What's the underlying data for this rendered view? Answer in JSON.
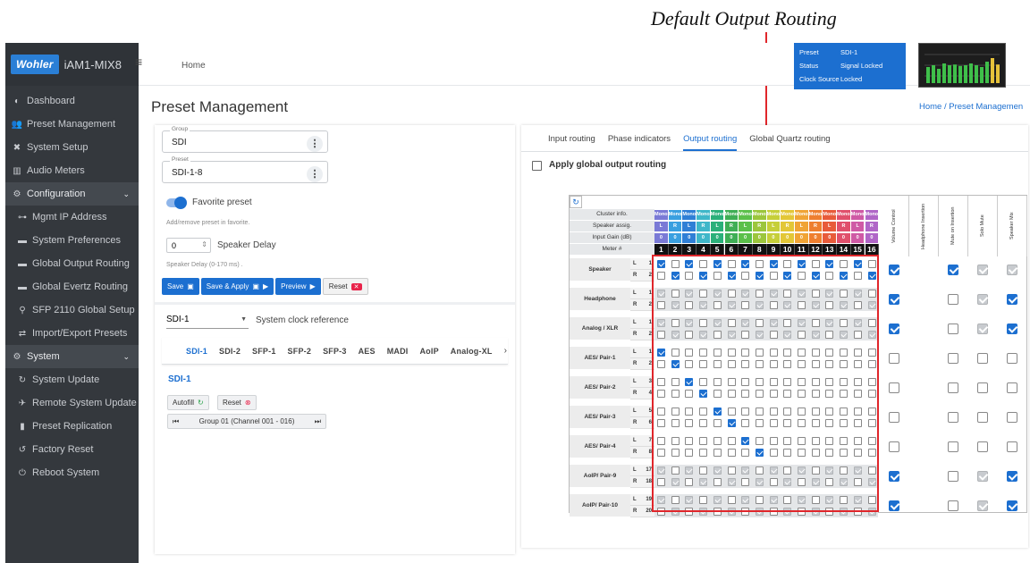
{
  "annotation": {
    "caption": "Default Output Routing"
  },
  "app": {
    "logo": "Wohler",
    "title": "iAM1-MIX8"
  },
  "sidebar": {
    "items": [
      {
        "label": "Dashboard",
        "icon": "dashboard-icon",
        "kind": "item"
      },
      {
        "label": "Preset Management",
        "icon": "users-icon",
        "kind": "item"
      },
      {
        "label": "System Setup",
        "icon": "tools-icon",
        "kind": "item"
      },
      {
        "label": "Audio Meters",
        "icon": "bar-chart-icon",
        "kind": "item"
      },
      {
        "label": "Configuration",
        "icon": "gear-icon",
        "kind": "group"
      },
      {
        "label": "Mgmt IP Address",
        "icon": "network-icon",
        "kind": "sub"
      },
      {
        "label": "System Preferences",
        "icon": "card-icon",
        "kind": "sub"
      },
      {
        "label": "Global Output Routing",
        "icon": "card-icon",
        "kind": "sub"
      },
      {
        "label": "Global Evertz Routing",
        "icon": "card-icon",
        "kind": "sub"
      },
      {
        "label": "SFP 2110 Global Setup",
        "icon": "plug-icon",
        "kind": "sub"
      },
      {
        "label": "Import/Export Presets",
        "icon": "swap-icon",
        "kind": "sub"
      },
      {
        "label": "System",
        "icon": "gears-icon",
        "kind": "group"
      },
      {
        "label": "System Update",
        "icon": "refresh-icon",
        "kind": "sub"
      },
      {
        "label": "Remote System Update",
        "icon": "satellite-icon",
        "kind": "sub"
      },
      {
        "label": "Preset Replication",
        "icon": "file-icon",
        "kind": "sub"
      },
      {
        "label": "Factory Reset",
        "icon": "undo-icon",
        "kind": "sub"
      },
      {
        "label": "Reboot System",
        "icon": "power-icon",
        "kind": "sub"
      }
    ]
  },
  "topbar": {
    "home": "Home",
    "status": [
      {
        "key": "Preset",
        "value": "SDI-1"
      },
      {
        "key": "Status",
        "value": "Signal Locked"
      },
      {
        "key": "Clock Source",
        "value": "Locked"
      }
    ]
  },
  "page": {
    "title": "Preset Management",
    "breadcrumb": "Home / Preset Managemen"
  },
  "left": {
    "group_label": "Group",
    "group_value": "SDI",
    "preset_label": "Preset",
    "preset_value": "SDI-1-8",
    "favorite_label": "Favorite preset",
    "favorite_hint": "Add/remove preset in favorite.",
    "speaker_delay_value": "0",
    "speaker_delay_label": "Speaker Delay",
    "speaker_delay_hint": "Speaker Delay (0-170 ms) .",
    "buttons": {
      "save": "Save",
      "save_apply": "Save & Apply",
      "preview": "Preview",
      "reset": "Reset"
    },
    "clock_select": "SDI-1",
    "clock_label": "System clock reference",
    "source_tabs": [
      "SDI-1",
      "SDI-2",
      "SFP-1",
      "SFP-2",
      "SFP-3",
      "AES",
      "MADI",
      "AoIP",
      "Analog-XL"
    ],
    "active_source": "SDI-1",
    "autofill": "Autofill",
    "reset_small": "Reset",
    "group_nav": "Group 01 (Channel 001 - 016)"
  },
  "right": {
    "tabs": [
      "Input routing",
      "Phase indicators",
      "Output routing",
      "Global Quartz routing"
    ],
    "active_tab": "Output routing",
    "apply_global": "Apply global output routing",
    "matrix": {
      "header_rows": [
        "Cluster info.",
        "Speaker assig.",
        "Input Gain (dB)",
        "Meter #"
      ],
      "cluster": "Mono",
      "speaker_assign": [
        "L",
        "R",
        "L",
        "R",
        "L",
        "R",
        "L",
        "R",
        "L",
        "R",
        "L",
        "R",
        "L",
        "R",
        "L",
        "R"
      ],
      "gain": "0",
      "meters": [
        "1",
        "2",
        "3",
        "4",
        "5",
        "6",
        "7",
        "8",
        "9",
        "10",
        "11",
        "12",
        "13",
        "14",
        "15",
        "16"
      ],
      "band_colors": [
        "#7a7ad6",
        "#3aa0e0",
        "#2f7fd6",
        "#3fb7c9",
        "#2bb07a",
        "#3fae55",
        "#5bc04a",
        "#9cc63c",
        "#c6cf39",
        "#e3c737",
        "#f0a436",
        "#ee7f2f",
        "#e85b3a",
        "#e0506c",
        "#cf5aa5",
        "#b066c7"
      ],
      "control_headers": [
        "Volume Control",
        "Headphone Insertion",
        "Mute on Insertion",
        "Solo Mute",
        "Speaker Mix"
      ],
      "sources": [
        {
          "name": "Speaker",
          "rows": [
            [
              "L",
              "1"
            ],
            [
              "R",
              "2"
            ]
          ]
        },
        {
          "name": "Headphone",
          "rows": [
            [
              "L",
              "1"
            ],
            [
              "R",
              "2"
            ]
          ]
        },
        {
          "name": "Analog / XLR",
          "rows": [
            [
              "L",
              "1"
            ],
            [
              "R",
              "2"
            ]
          ]
        },
        {
          "name": "AES/ Pair-1",
          "rows": [
            [
              "L",
              "1"
            ],
            [
              "R",
              "2"
            ]
          ]
        },
        {
          "name": "AES/ Pair-2",
          "rows": [
            [
              "L",
              "3"
            ],
            [
              "R",
              "4"
            ]
          ]
        },
        {
          "name": "AES/ Pair-3",
          "rows": [
            [
              "L",
              "5"
            ],
            [
              "R",
              "6"
            ]
          ]
        },
        {
          "name": "AES/ Pair-4",
          "rows": [
            [
              "L",
              "7"
            ],
            [
              "R",
              "8"
            ]
          ]
        },
        {
          "name": "AoIP/ Pair-9",
          "rows": [
            [
              "L",
              "17"
            ],
            [
              "R",
              "18"
            ]
          ]
        },
        {
          "name": "AoIP/ Pair-10",
          "rows": [
            [
              "L",
              "19"
            ],
            [
              "R",
              "20"
            ]
          ]
        }
      ],
      "controls": [
        [
          "on",
          "on",
          "dim",
          "dim"
        ],
        [
          "on",
          "off",
          "dim",
          "on"
        ],
        [
          "on",
          "off",
          "dim",
          "on"
        ],
        [
          "off",
          "off",
          "off",
          "off"
        ],
        [
          "off",
          "off",
          "off",
          "off"
        ],
        [
          "off",
          "off",
          "off",
          "off"
        ],
        [
          "off",
          "off",
          "off",
          "off"
        ],
        [
          "on",
          "off",
          "dim",
          "on"
        ],
        [
          "on",
          "off",
          "dim",
          "on"
        ]
      ]
    }
  }
}
